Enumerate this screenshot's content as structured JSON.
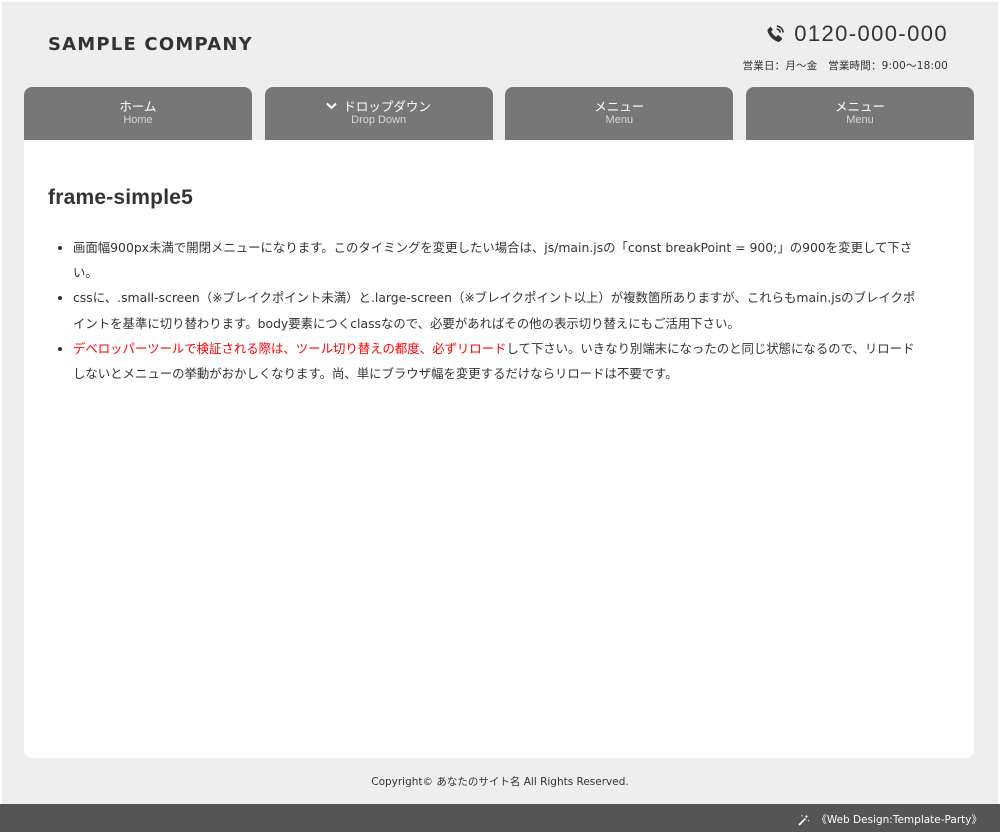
{
  "header": {
    "logo": "SAMPLE COMPANY",
    "tel": "0120-000-000",
    "tel_icon": "phone-icon",
    "hours": "営業日：月〜金　営業時間：9:00〜18:00"
  },
  "nav": {
    "items": [
      {
        "label": "ホーム",
        "sub": "Home"
      },
      {
        "label": "ドロップダウン",
        "sub": "Drop Down",
        "icon": "chevron-down-icon"
      },
      {
        "label": "メニュー",
        "sub": "Menu"
      },
      {
        "label": "メニュー",
        "sub": "Menu"
      }
    ]
  },
  "main": {
    "title": "frame-simple5",
    "notes": [
      {
        "text": "画面幅900px未満で開閉メニューになります。このタイミングを変更したい場合は、js/main.jsの「const breakPoint = 900;」の900を変更して下さい。"
      },
      {
        "text": "cssに、.small-screen（※ブレイクポイント未満）と.large-screen（※ブレイクポイント以上）が複数箇所ありますが、これらもmain.jsのブレイクポイントを基準に切り替わります。body要素につくclassなので、必要があればその他の表示切り替えにもご活用下さい。"
      },
      {
        "red": "デベロッパーツールで検証される際は、ツール切り替えの都度、必ずリロード",
        "text": "して下さい。いきなり別端末になったのと同じ状態になるので、リロードしないとメニューの挙動がおかしくなります。尚、単にブラウザ幅を変更するだけならリロードは不要です。"
      }
    ]
  },
  "footer": {
    "copyright": "Copyright© あなたのサイト名 All Rights Reserved.",
    "credit": "《Web Design:Template-Party》",
    "credit_icon": "magic-wand-icon"
  },
  "colors": {
    "background": "#eeeeee",
    "nav": "#777777",
    "footer_bar": "#555555",
    "accent_red": "#ff0000"
  }
}
